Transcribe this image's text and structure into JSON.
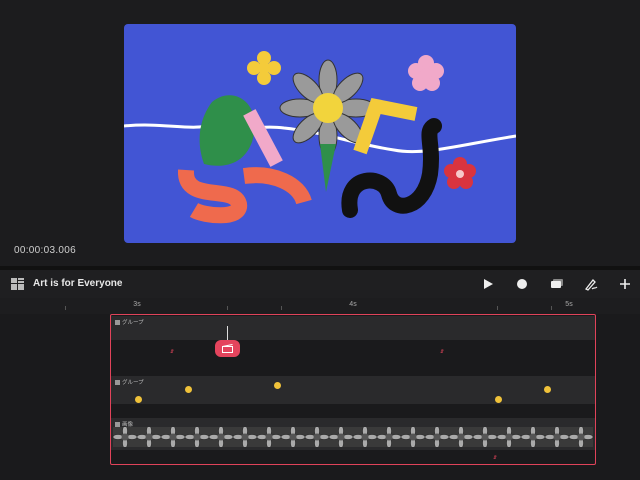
{
  "preview": {
    "timecode": "00:00:03.006"
  },
  "toolbar": {
    "project_title": "Art is for Everyone"
  },
  "ruler": {
    "labels": [
      "3s",
      "4s",
      "5s"
    ]
  },
  "tracks": [
    {
      "label": "グループ"
    },
    {
      "label": "グループ"
    },
    {
      "label": "画像"
    }
  ],
  "colors": {
    "canvas_bg": "#4255d4",
    "accent_red": "#e4445d",
    "keyframe_yellow": "#f0c23a"
  }
}
